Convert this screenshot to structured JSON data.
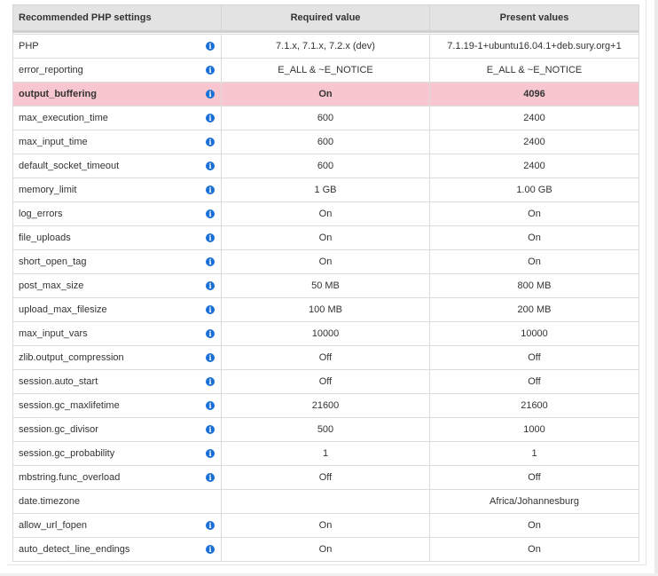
{
  "colors": {
    "highlight": "#f7c6cf",
    "info_icon": "#1a6fd6",
    "header_bg": "#e3e3e3"
  },
  "header": {
    "col1": "Recommended PHP settings",
    "col2": "Required value",
    "col3": "Present values"
  },
  "rows": [
    {
      "name": "PHP",
      "required": "7.1.x, 7.1.x, 7.2.x (dev)",
      "present": "7.1.19-1+ubuntu16.04.1+deb.sury.org+1",
      "info": true,
      "highlight": false
    },
    {
      "name": "error_reporting",
      "required": "E_ALL & ~E_NOTICE",
      "present": "E_ALL & ~E_NOTICE",
      "info": true,
      "highlight": false
    },
    {
      "name": "output_buffering",
      "required": "On",
      "present": "4096",
      "info": true,
      "highlight": true
    },
    {
      "name": "max_execution_time",
      "required": "600",
      "present": "2400",
      "info": true,
      "highlight": false
    },
    {
      "name": "max_input_time",
      "required": "600",
      "present": "2400",
      "info": true,
      "highlight": false
    },
    {
      "name": "default_socket_timeout",
      "required": "600",
      "present": "2400",
      "info": true,
      "highlight": false
    },
    {
      "name": "memory_limit",
      "required": "1 GB",
      "present": "1.00 GB",
      "info": true,
      "highlight": false
    },
    {
      "name": "log_errors",
      "required": "On",
      "present": "On",
      "info": true,
      "highlight": false
    },
    {
      "name": "file_uploads",
      "required": "On",
      "present": "On",
      "info": true,
      "highlight": false
    },
    {
      "name": "short_open_tag",
      "required": "On",
      "present": "On",
      "info": true,
      "highlight": false
    },
    {
      "name": "post_max_size",
      "required": "50 MB",
      "present": "800 MB",
      "info": true,
      "highlight": false
    },
    {
      "name": "upload_max_filesize",
      "required": "100 MB",
      "present": "200 MB",
      "info": true,
      "highlight": false
    },
    {
      "name": "max_input_vars",
      "required": "10000",
      "present": "10000",
      "info": true,
      "highlight": false
    },
    {
      "name": "zlib.output_compression",
      "required": "Off",
      "present": "Off",
      "info": true,
      "highlight": false
    },
    {
      "name": "session.auto_start",
      "required": "Off",
      "present": "Off",
      "info": true,
      "highlight": false
    },
    {
      "name": "session.gc_maxlifetime",
      "required": "21600",
      "present": "21600",
      "info": true,
      "highlight": false
    },
    {
      "name": "session.gc_divisor",
      "required": "500",
      "present": "1000",
      "info": true,
      "highlight": false
    },
    {
      "name": "session.gc_probability",
      "required": "1",
      "present": "1",
      "info": true,
      "highlight": false
    },
    {
      "name": "mbstring.func_overload",
      "required": "Off",
      "present": "Off",
      "info": true,
      "highlight": false
    },
    {
      "name": "date.timezone",
      "required": "",
      "present": "Africa/Johannesburg",
      "info": false,
      "highlight": false
    },
    {
      "name": "allow_url_fopen",
      "required": "On",
      "present": "On",
      "info": true,
      "highlight": false
    },
    {
      "name": "auto_detect_line_endings",
      "required": "On",
      "present": "On",
      "info": true,
      "highlight": false
    }
  ]
}
